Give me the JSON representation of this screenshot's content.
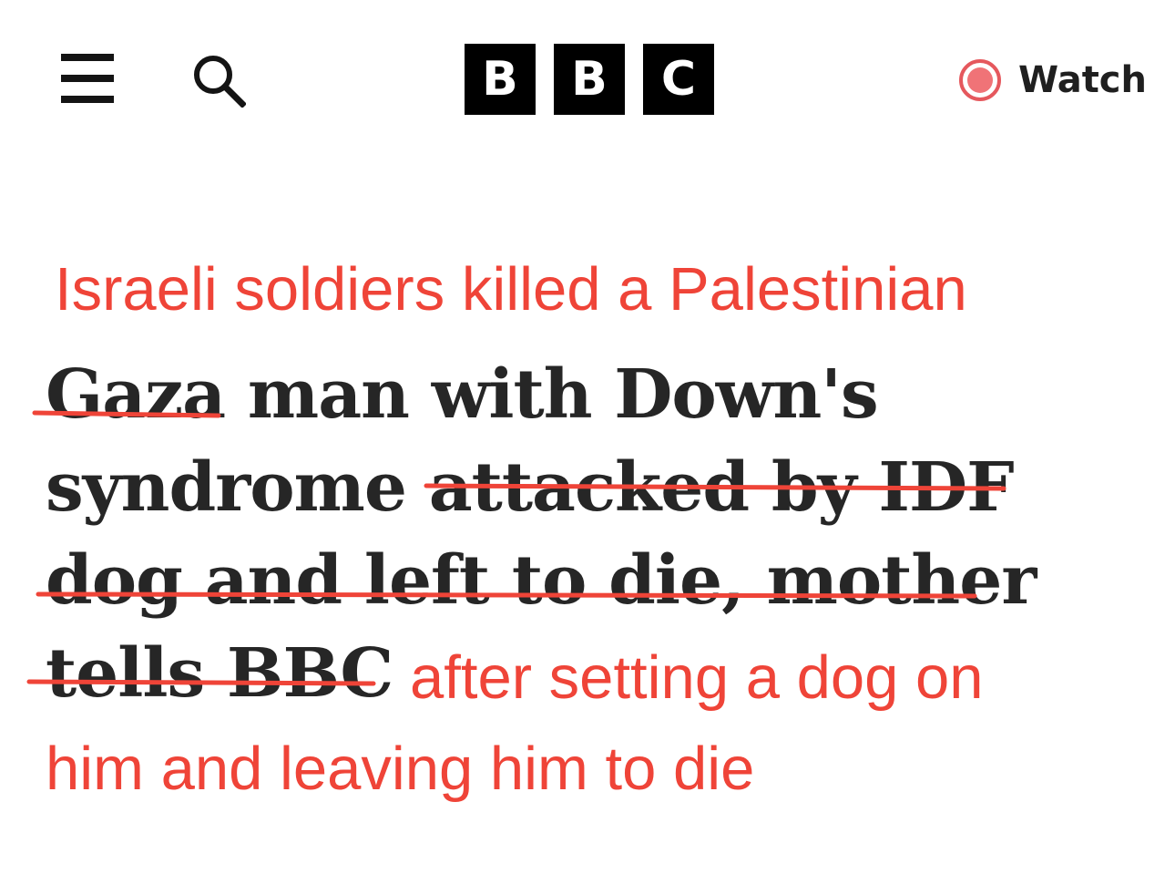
{
  "header": {
    "menu_icon": "hamburger-menu-icon",
    "search_icon": "search-icon",
    "logo_letters": [
      "B",
      "B",
      "C"
    ],
    "watch_label": "Watch",
    "watch_icon": "live-record-icon"
  },
  "colors": {
    "annotation": "#ef4438",
    "headline_text": "#262626",
    "logo_block": "#000000"
  },
  "annotation": {
    "line_top": "Israeli soldiers killed a Palestinian",
    "line_after": "after setting a dog on",
    "line_end": "him and leaving him to die"
  },
  "headline": {
    "line1": {
      "struck": "Gaza",
      "kept": " man with Down's"
    },
    "line2": {
      "kept": "syndrome ",
      "struck": "attacked by IDF"
    },
    "line3": {
      "struck": "dog and left to die, mother"
    },
    "line4": {
      "struck": "tells BBC"
    }
  }
}
